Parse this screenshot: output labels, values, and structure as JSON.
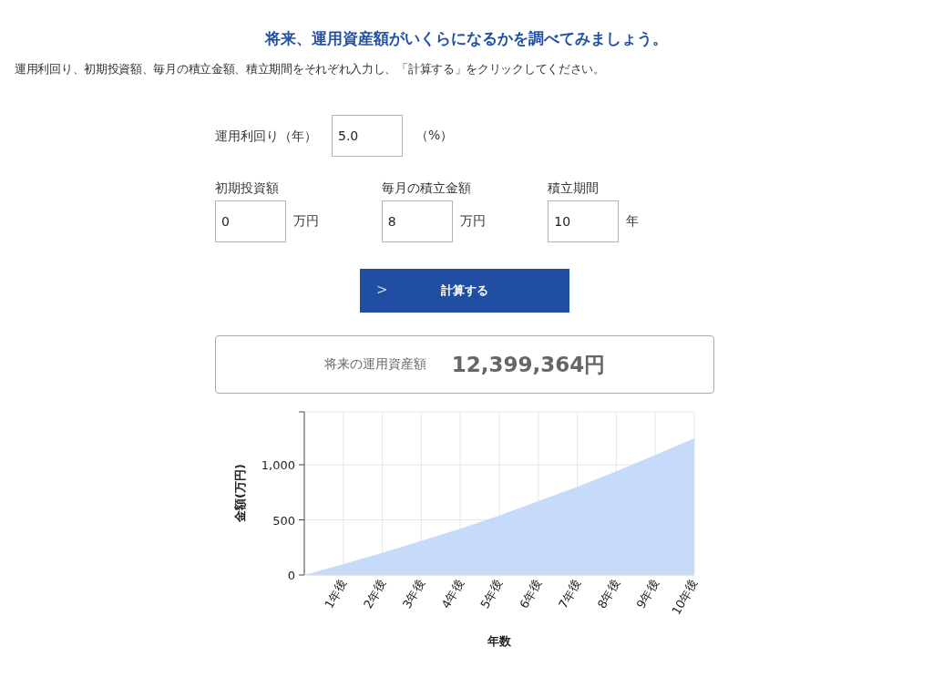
{
  "heading": "将来、運用資産額がいくらになるかを調べてみましょう。",
  "description": "運用利回り、初期投資額、毎月の積立金額、積立期間をそれぞれ入力し、「計算する」をクリックしてください。",
  "rate_field": {
    "label": "運用利回り（年）",
    "value": "5.0",
    "unit": "（%）"
  },
  "fields": [
    {
      "label": "初期投資額",
      "value": "0",
      "unit": "万円"
    },
    {
      "label": "毎月の積立金額",
      "value": "8",
      "unit": "万円"
    },
    {
      "label": "積立期間",
      "value": "10",
      "unit": "年"
    }
  ],
  "calculate_button": {
    "icon": ">",
    "label": "計算する"
  },
  "result": {
    "label": "将来の運用資産額",
    "value": "12,399,364円"
  },
  "chart_data": {
    "type": "area",
    "xlabel": "年数",
    "ylabel": "金額(万円)",
    "x": [
      0,
      1,
      2,
      3,
      4,
      5,
      6,
      7,
      8,
      9,
      10
    ],
    "grid": true,
    "series": [
      {
        "color": "#c6dbf9",
        "values": [
          0,
          100,
          200,
          310,
          420,
          540,
          670,
          800,
          940,
          1090,
          1240
        ]
      }
    ],
    "xlim": [
      0,
      10
    ],
    "ylim": [
      0,
      1480
    ],
    "xticks": [
      {
        "value": 1,
        "label": "1年後"
      },
      {
        "value": 2,
        "label": "2年後"
      },
      {
        "value": 3,
        "label": "3年後"
      },
      {
        "value": 4,
        "label": "4年後"
      },
      {
        "value": 5,
        "label": "5年後"
      },
      {
        "value": 6,
        "label": "6年後"
      },
      {
        "value": 7,
        "label": "7年後"
      },
      {
        "value": 8,
        "label": "8年後"
      },
      {
        "value": 9,
        "label": "9年後"
      },
      {
        "value": 10,
        "label": "10年後"
      }
    ],
    "yticks": [
      {
        "value": 0,
        "label": "0"
      },
      {
        "value": 500,
        "label": "500"
      },
      {
        "value": 1000,
        "label": "1,000"
      }
    ]
  }
}
